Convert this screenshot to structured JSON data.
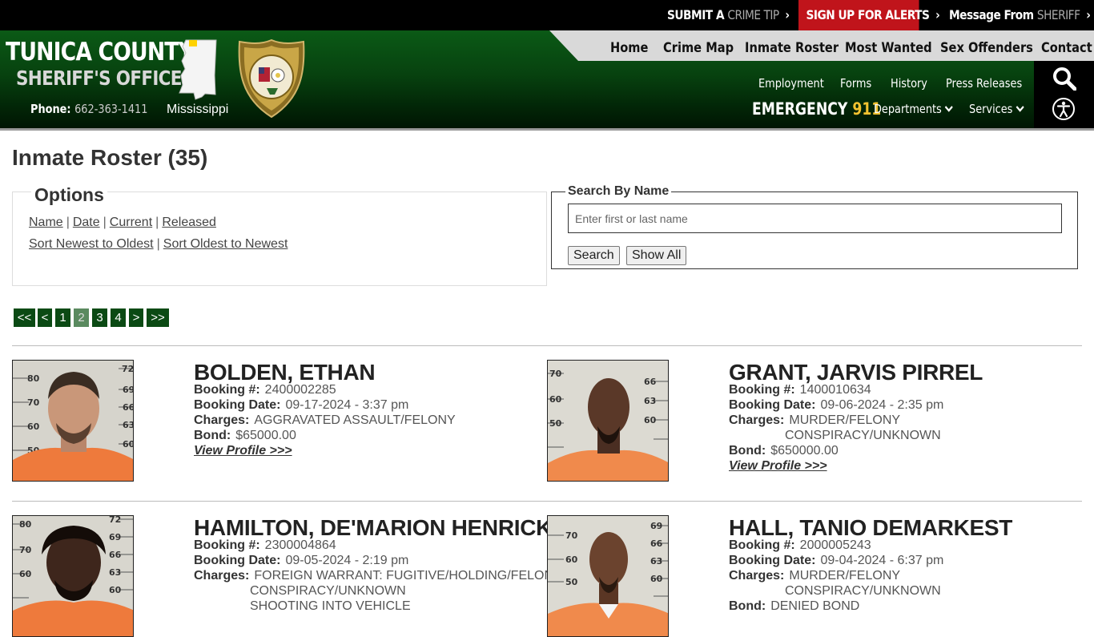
{
  "topbar": {
    "tip_a": "SUBMIT A",
    "tip_b": "CRIME TIP",
    "alerts": "SIGN UP FOR ALERTS",
    "msg_a": "Message From",
    "msg_b": "SHERIFF",
    "chevron": "›"
  },
  "header": {
    "brand_line1": "TUNICA COUNTY",
    "brand_line2": "SHERIFF'S OFFICE",
    "phone_label": "Phone:",
    "phone_number": "662-363-1411",
    "state": "Mississippi",
    "emergency_label": "EMERGENCY",
    "emergency_number": "911"
  },
  "nav_primary": [
    "Home",
    "Crime Map",
    "Inmate Roster",
    "Most Wanted",
    "Sex Offenders",
    "Contact"
  ],
  "nav_secondary": [
    "Employment",
    "Forms",
    "History",
    "Press Releases"
  ],
  "nav_dropdowns": [
    "Departments",
    "Services"
  ],
  "icons": {
    "search": "search-icon",
    "accessibility": "accessibility-icon"
  },
  "page": {
    "title": "Inmate Roster (35)"
  },
  "options": {
    "legend": "Options",
    "sort_by": [
      "Name",
      "Date",
      "Current",
      "Released"
    ],
    "order": [
      "Sort Newest to Oldest",
      "Sort Oldest to Newest"
    ],
    "separator": "|"
  },
  "search": {
    "legend": "Search By Name",
    "placeholder": "Enter first or last name",
    "value": "",
    "search_button": "Search",
    "show_all_button": "Show All"
  },
  "pagination": {
    "first": "<<",
    "prev": "<",
    "pages": [
      "1",
      "2",
      "3",
      "4"
    ],
    "current": "2",
    "next": ">",
    "last": ">>"
  },
  "inmates": [
    {
      "name": "BOLDEN, ETHAN",
      "booking_label": "Booking #:",
      "booking": "2400002285",
      "date_label": "Booking Date:",
      "date": "09-17-2024 - 3:37 pm",
      "charges_label": "Charges:",
      "charges": [
        "AGGRAVATED ASSAULT/FELONY"
      ],
      "bond_label": "Bond:",
      "bond": "$65000.00",
      "profile": "View Profile >>>"
    },
    {
      "name": "GRANT, JARVIS PIRREL",
      "booking_label": "Booking #:",
      "booking": "1400010634",
      "date_label": "Booking Date:",
      "date": "09-06-2024 - 2:35 pm",
      "charges_label": "Charges:",
      "charges": [
        "MURDER/FELONY",
        "CONSPIRACY/UNKNOWN"
      ],
      "bond_label": "Bond:",
      "bond": "$650000.00",
      "profile": "View Profile >>>"
    },
    {
      "name": "HAMILTON, DE'MARION HENRICK",
      "booking_label": "Booking #:",
      "booking": "2300004864",
      "date_label": "Booking Date:",
      "date": "09-05-2024 - 2:19 pm",
      "charges_label": "Charges:",
      "charges": [
        "FOREIGN WARRANT: FUGITIVE/HOLDING/FELONY",
        "CONSPIRACY/UNKNOWN",
        "SHOOTING INTO VEHICLE"
      ],
      "bond_label": "Bond:",
      "bond": "",
      "profile": ""
    },
    {
      "name": "HALL, TANIO DEMARKEST",
      "booking_label": "Booking #:",
      "booking": "2000005243",
      "date_label": "Booking Date:",
      "date": "09-04-2024 - 6:37 pm",
      "charges_label": "Charges:",
      "charges": [
        "MURDER/FELONY",
        "CONSPIRACY/UNKNOWN"
      ],
      "bond_label": "Bond:",
      "bond": "DENIED BOND",
      "profile": ""
    }
  ],
  "mugshot_scale": {
    "left_ticks": [
      "80",
      "70",
      "60",
      "50"
    ],
    "right_ticks": [
      "72",
      "69",
      "66",
      "63",
      "60"
    ]
  }
}
